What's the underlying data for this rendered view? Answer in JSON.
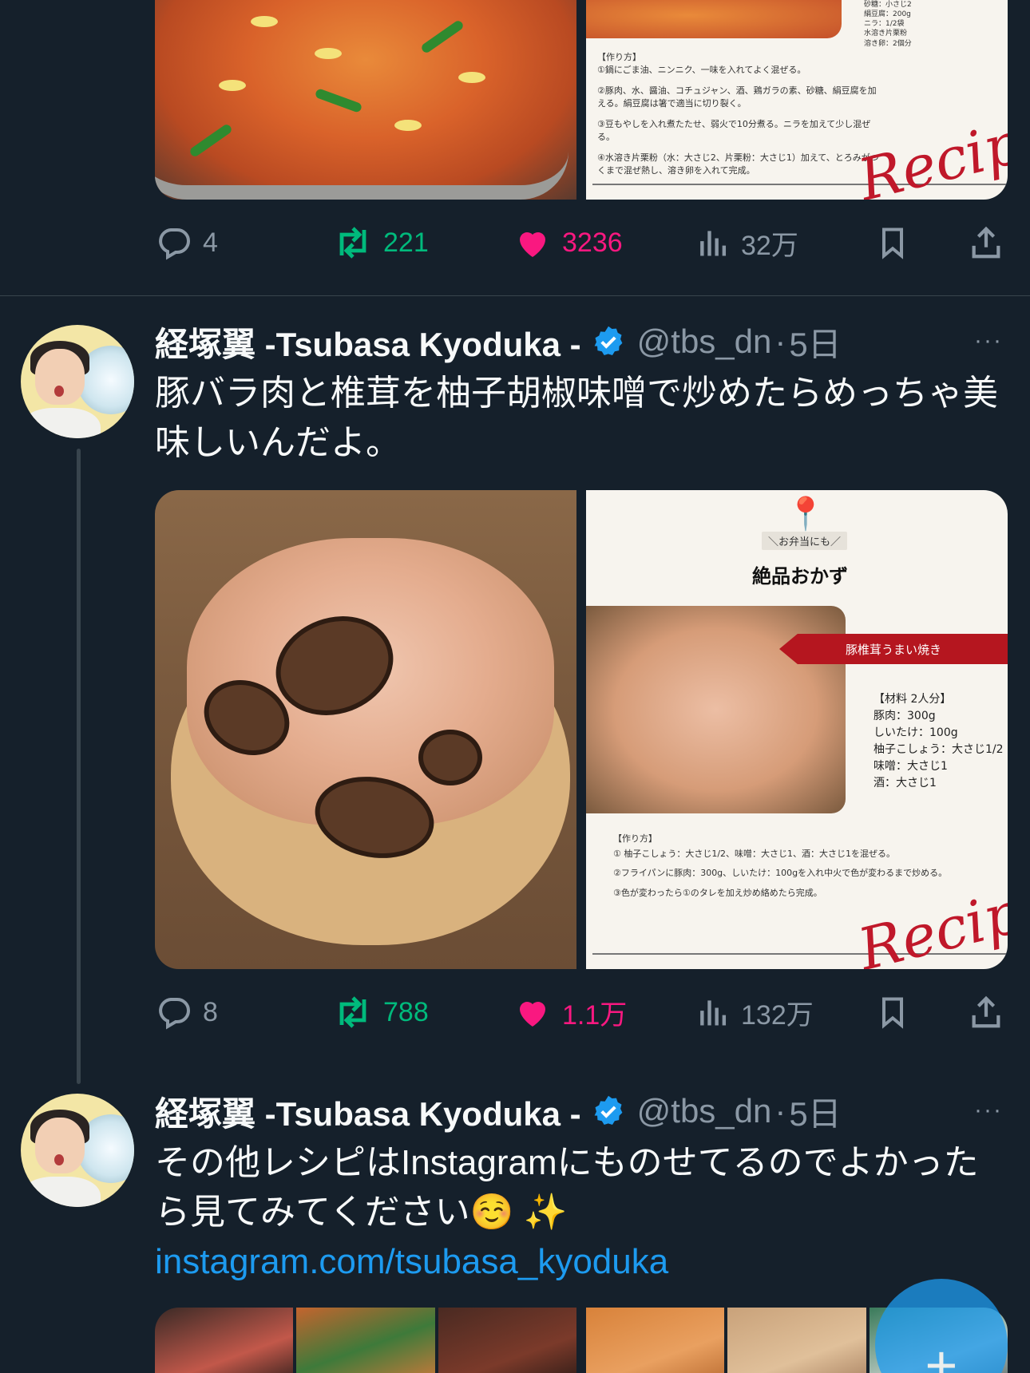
{
  "colors": {
    "background": "#15202b",
    "text": "#f7f9f9",
    "muted": "#8b98a5",
    "retweet": "#00ba7c",
    "like": "#f91880",
    "link": "#1d9bf0",
    "divider": "#38444d"
  },
  "tweet1": {
    "recipe_lines": [
      "砂糖：小さじ2",
      "絹豆腐：200g",
      "ニラ：1/2袋",
      "水溶き片栗粉",
      "溶き卵：2個分"
    ],
    "steps_title": "【作り方】",
    "steps": [
      "①鍋にごま油、ニンニク、一味を入れてよく混ぜる。",
      "②豚肉、水、醤油、コチュジャン、酒、鶏ガラの素、砂糖、絹豆腐を加える。絹豆腐は箸で適当に切り裂く。",
      "③豆もやしを入れ煮たたせ、弱火で10分煮る。ニラを加えて少し混ぜる。",
      "④水溶き片栗粉（水：大さじ2、片栗粉：大さじ1）加えて、とろみがつくまで混ぜ熱し、溶き卵を入れて完成。"
    ],
    "script_word": "Recip",
    "actions": {
      "replies": "4",
      "retweets": "221",
      "likes": "3236",
      "views": "32万"
    }
  },
  "tweet2": {
    "author_name": "経塚翼 -Tsubasa Kyoduka -",
    "handle": "@tbs_dn",
    "separator": "·",
    "time": "5日",
    "text": "豚バラ肉と椎茸を柚子胡椒味噌で炒めたらめっちゃ美味しいんだよ。",
    "card": {
      "tag": "＼お弁当にも／",
      "title": "絶品おかず",
      "banner": "豚椎茸うまい焼き",
      "ingredients": [
        "【材料 2人分】",
        "豚肉：300g",
        "しいたけ：100g",
        "柚子こしょう：大さじ1/2",
        "味噌：大さじ1",
        "酒：大さじ1"
      ],
      "steps_title": "【作り方】",
      "steps": [
        "① 柚子こしょう：大さじ1/2、味噌：大さじ1、酒：大さじ1を混ぜる。",
        "②フライパンに豚肉：300g、しいたけ：100gを入れ中火で色が変わるまで炒める。",
        "③色が変わったら①のタレを加え炒め絡めたら完成。"
      ],
      "script_word": "Recip"
    },
    "actions": {
      "replies": "8",
      "retweets": "788",
      "likes": "1.1万",
      "views": "132万"
    }
  },
  "tweet3": {
    "author_name": "経塚翼 -Tsubasa Kyoduka -",
    "handle": "@tbs_dn",
    "separator": "·",
    "time": "5日",
    "text": "その他レシピはInstagramにものせてるのでよかったら見てみてください☺️ ✨",
    "link": "instagram.com/tsubasa_kyoduka"
  },
  "icons": {
    "reply": "reply-icon",
    "retweet": "retweet-icon",
    "like": "heart-icon",
    "views": "views-icon",
    "bookmark": "bookmark-icon",
    "share": "share-icon",
    "verified": "verified-badge-icon",
    "more": "more-icon",
    "compose": "plus-icon"
  },
  "fab": {
    "symbol": "+"
  },
  "more_symbol": "···"
}
